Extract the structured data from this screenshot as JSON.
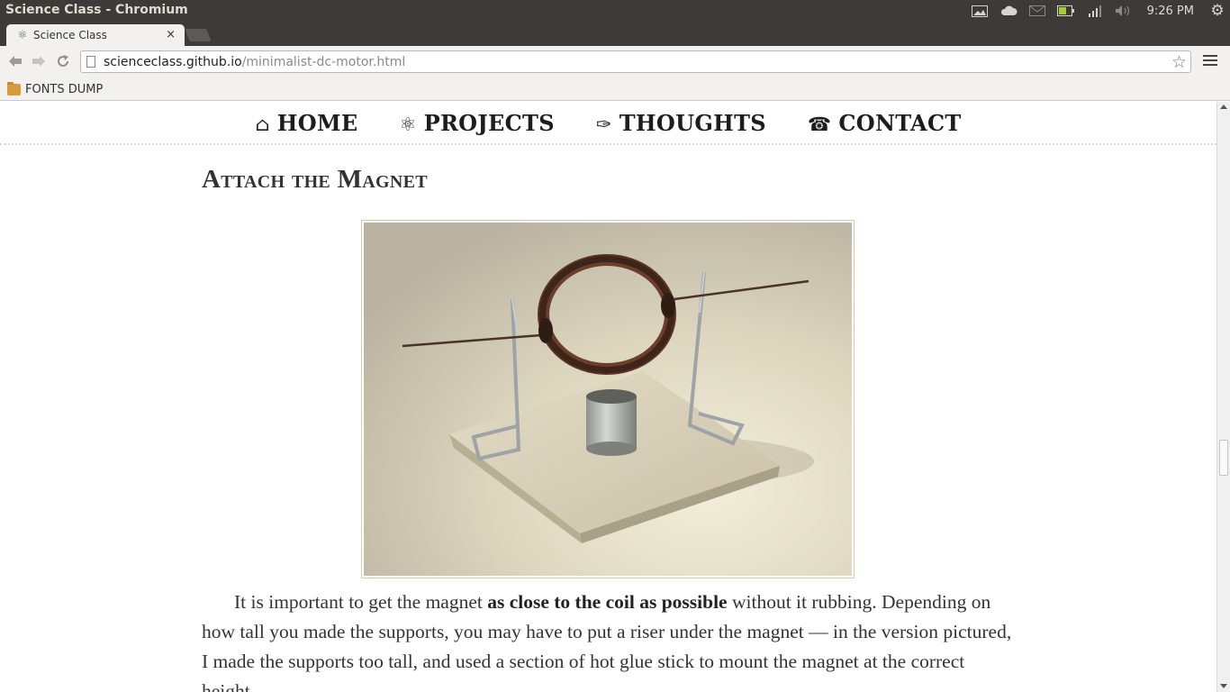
{
  "os_panel": {
    "window_title": "Science Class - Chromium",
    "clock": "9:26 PM"
  },
  "browser": {
    "tab_title": "Science Class",
    "url_host": "scienceclass.github.io",
    "url_path": "/minimalist-dc-motor.html",
    "bookmark_folder": "FONTS DUMP"
  },
  "site_nav": {
    "items": [
      {
        "glyph": "⌂",
        "label": "HOME"
      },
      {
        "glyph": "⚛",
        "label": "PROJECTS"
      },
      {
        "glyph": "✑",
        "label": "THOUGHTS"
      },
      {
        "glyph": "☎",
        "label": "CONTACT"
      }
    ]
  },
  "article": {
    "section_title": "Attach the Magnet",
    "para_intro": "It is important to get the magnet ",
    "para_bold": "as close to the coil as possible",
    "para_rest": " without it rubbing. Depending on how tall you made the supports, you may have to put a riser under the magnet — in the version pictured, I made the supports too tall, and used a section of hot glue stick to mount the magnet at the correct height."
  }
}
